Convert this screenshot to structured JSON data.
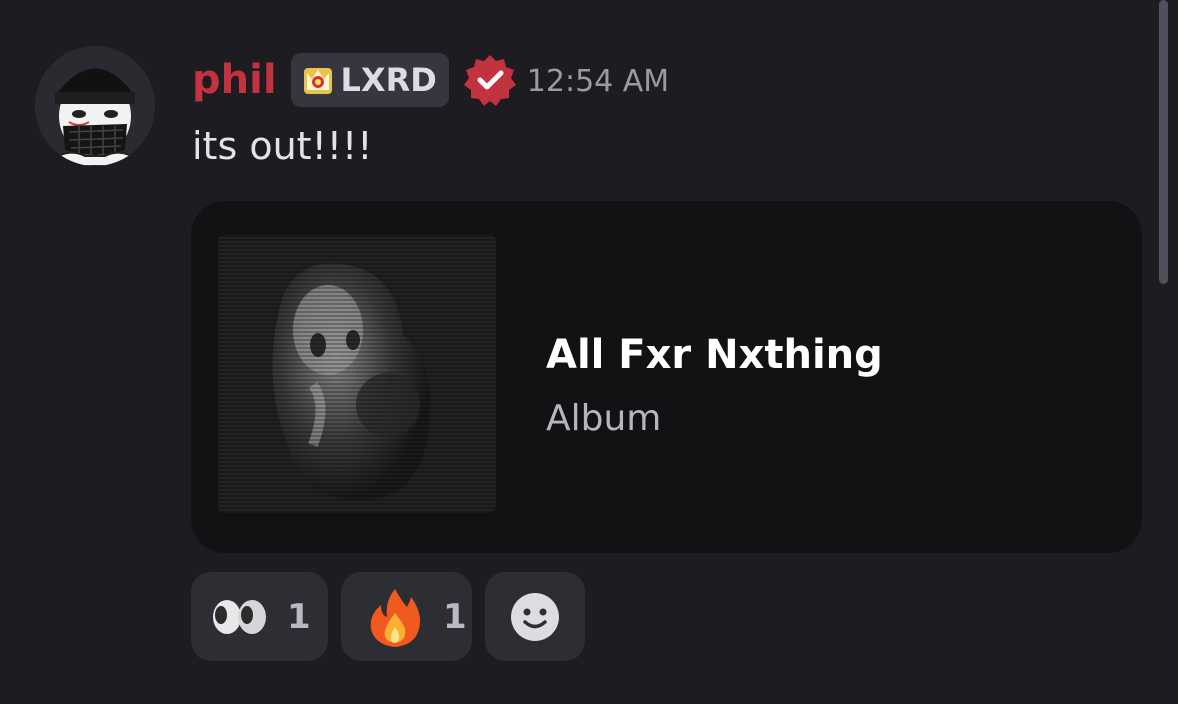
{
  "message": {
    "author": {
      "username": "phil",
      "username_color": "#c3323f",
      "tag": "LXRD",
      "tag_icon": "crown-tag-icon",
      "verified_icon": "verified-badge-icon"
    },
    "timestamp": "12:54 AM",
    "text": "its out!!!!"
  },
  "embed": {
    "title": "All Fxr Nxthing",
    "type_label": "Album"
  },
  "reactions": [
    {
      "emoji": "eyes-emoji",
      "count": "1"
    },
    {
      "emoji": "fire-emoji",
      "count": "1"
    }
  ],
  "add_reaction_icon": "smiley-icon"
}
